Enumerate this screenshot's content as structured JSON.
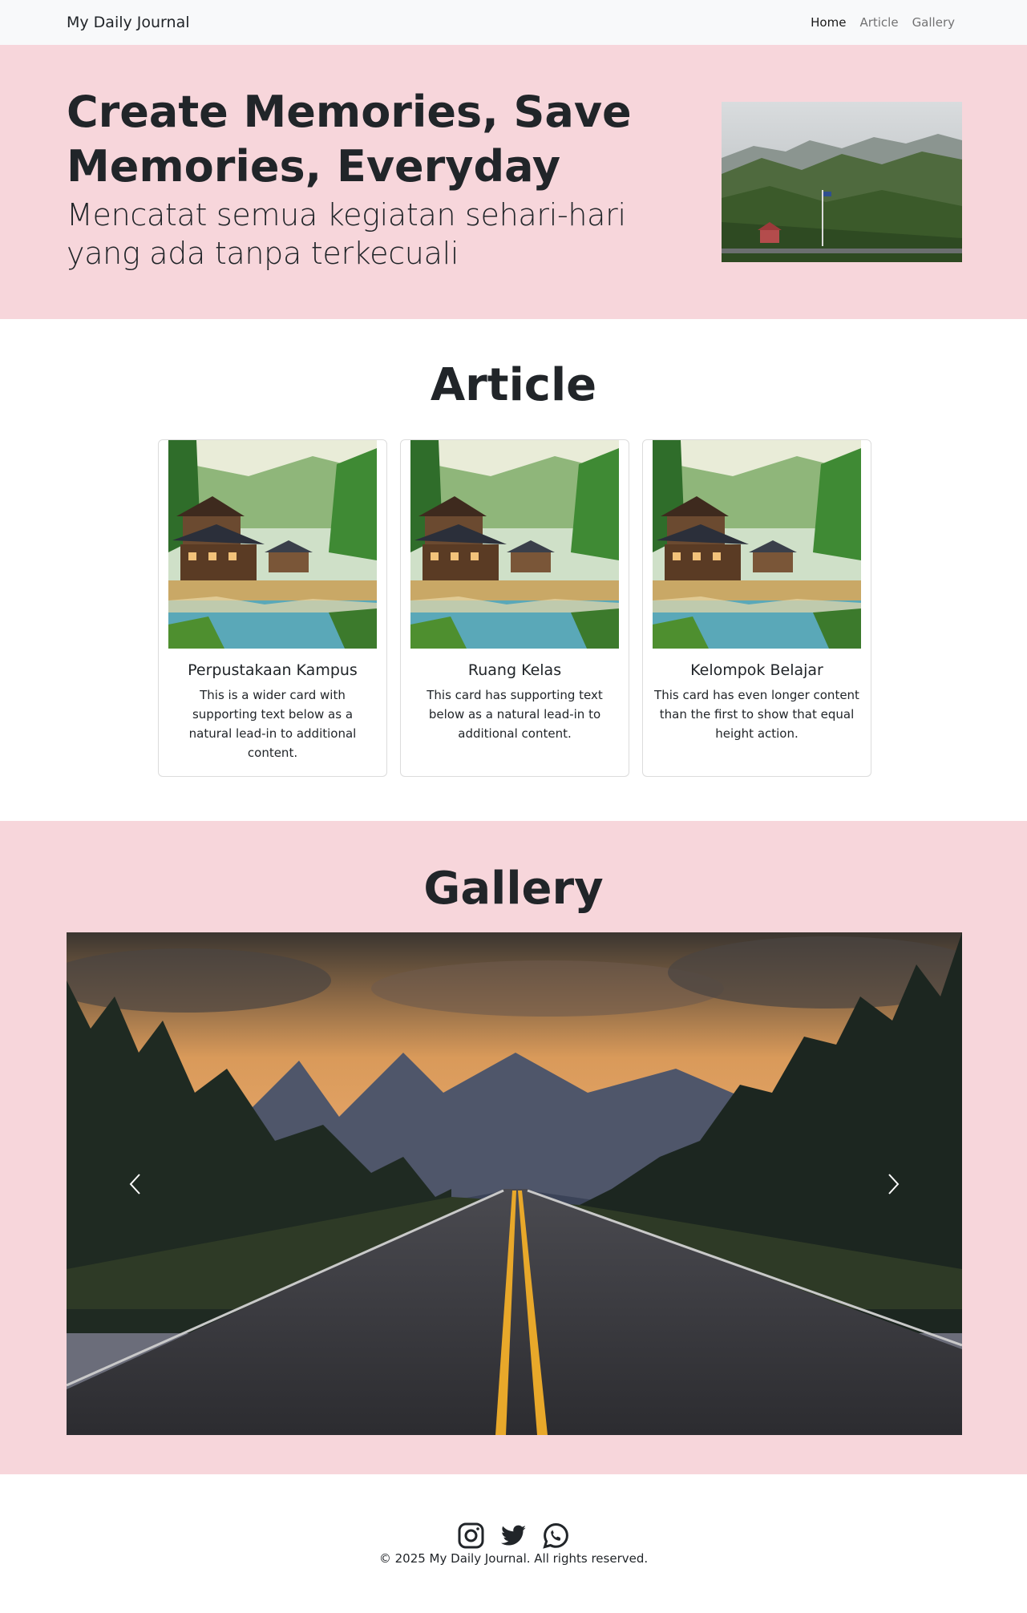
{
  "navbar": {
    "brand": "My Daily Journal",
    "links": [
      "Home",
      "Article",
      "Gallery"
    ]
  },
  "hero": {
    "title": "Create Memories, Save Memories, Everyday",
    "subtitle": "Mencatat semua kegiatan sehari-hari yang ada tanpa terkecuali"
  },
  "article": {
    "heading": "Article",
    "cards": [
      {
        "title": "Perpustakaan Kampus",
        "text": "This is a wider card with supporting text below as a natural lead-in to additional content."
      },
      {
        "title": "Ruang Kelas",
        "text": "This card has supporting text below as a natural lead-in to additional content."
      },
      {
        "title": "Kelompok Belajar",
        "text": "This card has even longer content than the first to show that equal height action."
      }
    ]
  },
  "gallery": {
    "heading": "Gallery"
  },
  "footer": {
    "icons": [
      "instagram-icon",
      "twitter-icon",
      "whatsapp-icon"
    ],
    "copyright": "© 2025 My Daily Journal. All rights reserved."
  },
  "colors": {
    "pink_bg": "#f7d6db",
    "navbar_bg": "#f8f9fa",
    "text": "#212529"
  }
}
